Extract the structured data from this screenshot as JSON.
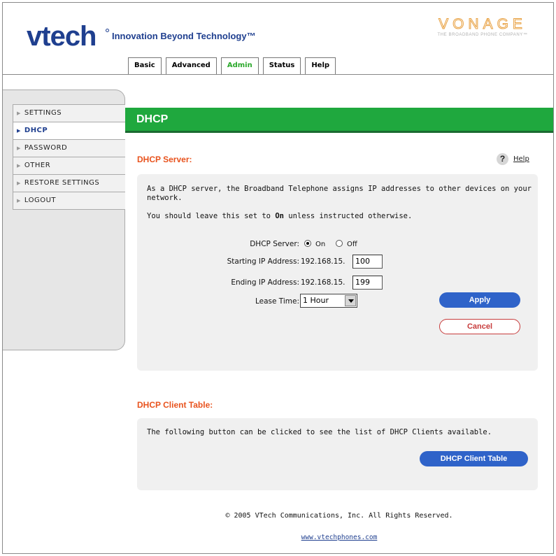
{
  "header": {
    "brand": "vtech",
    "tagline": "Innovation Beyond Technology™",
    "partner": "VONAGE",
    "partner_sub": "THE BROADBAND PHONE COMPANY™"
  },
  "tabs": [
    {
      "label": "Basic",
      "active": false
    },
    {
      "label": "Advanced",
      "active": false
    },
    {
      "label": "Admin",
      "active": true
    },
    {
      "label": "Status",
      "active": false
    },
    {
      "label": "Help",
      "active": false
    }
  ],
  "sidebar": {
    "items": [
      {
        "label": "SETTINGS",
        "active": false
      },
      {
        "label": "DHCP",
        "active": true
      },
      {
        "label": "PASSWORD",
        "active": false
      },
      {
        "label": "OTHER",
        "active": false
      },
      {
        "label": "RESTORE SETTINGS",
        "active": false
      },
      {
        "label": "LOGOUT",
        "active": false
      }
    ]
  },
  "page": {
    "title": "DHCP"
  },
  "help": {
    "icon": "?",
    "label": "Help"
  },
  "dhcp_server": {
    "section_title": "DHCP Server:",
    "description": "As a DHCP server, the Broadband Telephone assigns IP addresses to other devices on your network.",
    "advice_prefix": "You should leave this set to ",
    "advice_bold": "On",
    "advice_suffix": " unless instructed otherwise.",
    "server_label": "DHCP Server:",
    "on_label": "On",
    "off_label": "Off",
    "server_state": "On",
    "start_label": "Starting IP Address:",
    "start_prefix": "192.168.15.",
    "start_value": "100",
    "end_label": "Ending IP Address:",
    "end_prefix": "192.168.15.",
    "end_value": "199",
    "lease_label": "Lease Time:",
    "lease_value": "1 Hour",
    "apply_label": "Apply",
    "cancel_label": "Cancel"
  },
  "dhcp_clients": {
    "section_title": "DHCP Client Table:",
    "description": "The following button can be clicked to see the list of DHCP Clients available.",
    "button_label": "DHCP Client Table"
  },
  "footer": {
    "copyright": "© 2005 VTech Communications, Inc. All Rights Reserved.",
    "link": "www.vtechphones.com"
  },
  "colors": {
    "brand_blue": "#1f3f8f",
    "title_green": "#1fa83e",
    "section_orange": "#e8531e",
    "button_blue": "#2f63c9",
    "cancel_red": "#c73c3c"
  }
}
